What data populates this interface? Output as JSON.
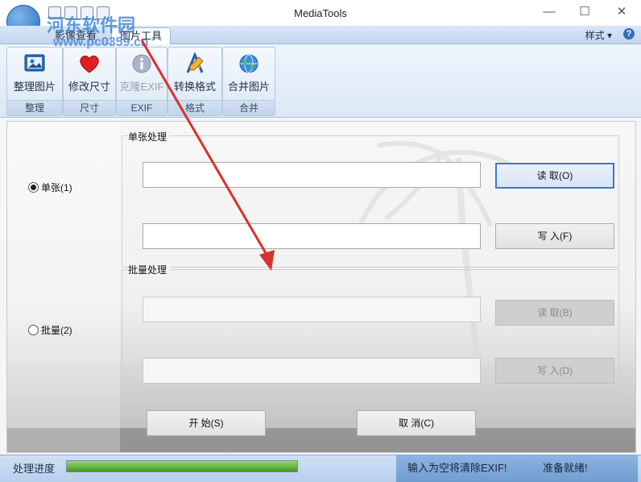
{
  "window": {
    "title": "MediaTools",
    "minimize_symbol": "—",
    "maximize_symbol": "☐",
    "close_symbol": "✕"
  },
  "watermark": {
    "line1": "河东软件园",
    "line2": "www.pc0359.cn"
  },
  "tabs": [
    {
      "label": "影像查看",
      "active": false
    },
    {
      "label": "图片工具",
      "active": true
    }
  ],
  "style_menu": {
    "label": "样式 ▾"
  },
  "help": {
    "symbol": "?"
  },
  "ribbon": {
    "groups": [
      {
        "label": "整理",
        "buttons": [
          {
            "label": "整理图片",
            "icon": "image-icon"
          }
        ]
      },
      {
        "label": "尺寸",
        "buttons": [
          {
            "label": "修改尺寸",
            "icon": "heart-icon"
          }
        ]
      },
      {
        "label": "EXIF",
        "buttons": [
          {
            "label": "克隆EXIF",
            "icon": "info-icon",
            "disabled": true
          }
        ]
      },
      {
        "label": "格式",
        "buttons": [
          {
            "label": "转换格式",
            "icon": "pencil-ruler-icon"
          }
        ]
      },
      {
        "label": "合并",
        "buttons": [
          {
            "label": "合并图片",
            "icon": "globe-icon"
          }
        ]
      }
    ]
  },
  "single": {
    "radio_label": "单张(1)",
    "selected": true,
    "group_title": "单张处理",
    "source_value": "",
    "target_value": "",
    "read_label": "读  取(O)",
    "write_label": "写  入(F)"
  },
  "batch": {
    "radio_label": "批量(2)",
    "selected": false,
    "group_title": "批量处理",
    "source_value": "",
    "target_value": "",
    "read_label": "读  取(B)",
    "write_label": "写  入(D)"
  },
  "actions": {
    "start_label": "开  始(S)",
    "cancel_label": "取  消(C)"
  },
  "status": {
    "progress_label": "处理进度",
    "progress_fraction": 1.0,
    "message": "输入为空将清除EXIF!",
    "state": "准备就绪!"
  },
  "colors": {
    "accent": "#3b79c8",
    "progress": "#3e9a1e",
    "annotation_arrow": "#d9312b"
  }
}
